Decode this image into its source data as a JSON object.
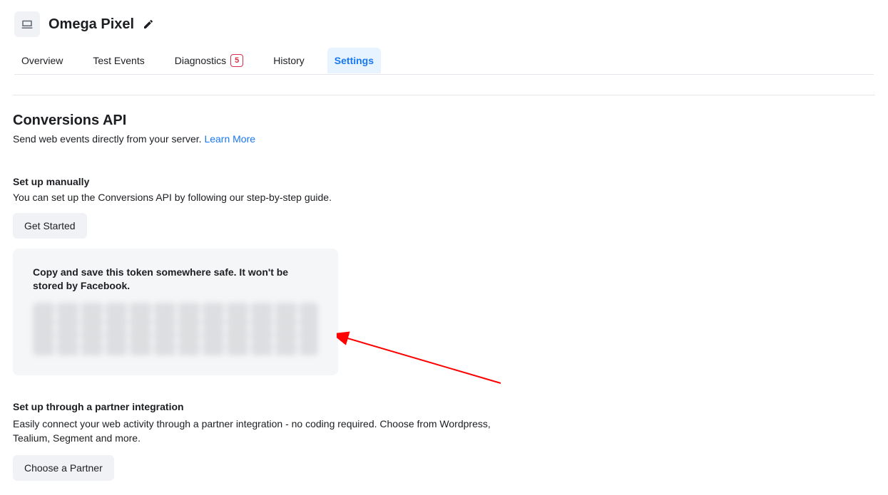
{
  "header": {
    "title": "Omega Pixel"
  },
  "tabs": [
    {
      "label": "Overview"
    },
    {
      "label": "Test Events"
    },
    {
      "label": "Diagnostics",
      "badge": "5"
    },
    {
      "label": "History"
    },
    {
      "label": "Settings",
      "active": true
    }
  ],
  "section": {
    "title": "Conversions API",
    "desc": "Send web events directly from your server.",
    "learn_more": "Learn More"
  },
  "manual": {
    "title": "Set up manually",
    "desc": "You can set up the Conversions API by following our step-by-step guide.",
    "button": "Get Started"
  },
  "token_panel": {
    "text": "Copy and save this token somewhere safe. It won't be stored by Facebook."
  },
  "partner": {
    "title": "Set up through a partner integration",
    "desc": "Easily connect your web activity through a partner integration - no coding required. Choose from Wordpress, Tealium, Segment and more.",
    "button": "Choose a Partner"
  }
}
